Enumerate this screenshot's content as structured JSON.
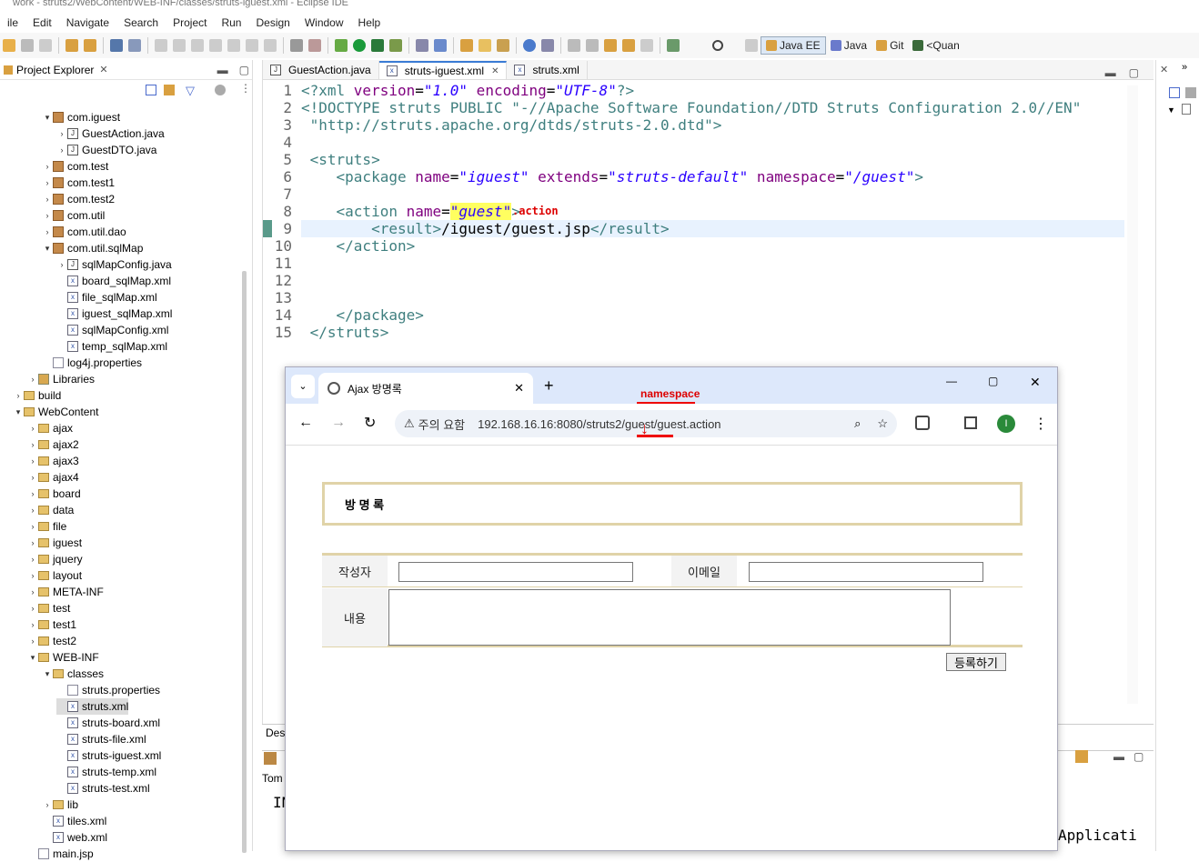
{
  "window": {
    "title": "work - struts2/WebContent/WEB-INF/classes/struts-iguest.xml - Eclipse IDE"
  },
  "menu": [
    "ile",
    "Edit",
    "Navigate",
    "Search",
    "Project",
    "Run",
    "Design",
    "Window",
    "Help"
  ],
  "perspectives": [
    "Java EE",
    "Java",
    "Git",
    "<Quan"
  ],
  "project_explorer": {
    "title": "Project Explorer",
    "items": [
      {
        "label": "com.iguest",
        "icon": "package"
      },
      {
        "label": "GuestAction.java",
        "icon": "java"
      },
      {
        "label": "GuestDTO.java",
        "icon": "java"
      },
      {
        "label": "com.test",
        "icon": "package"
      },
      {
        "label": "com.test1",
        "icon": "package"
      },
      {
        "label": "com.test2",
        "icon": "package"
      },
      {
        "label": "com.util",
        "icon": "package"
      },
      {
        "label": "com.util.dao",
        "icon": "package"
      },
      {
        "label": "com.util.sqlMap",
        "icon": "package"
      },
      {
        "label": "sqlMapConfig.java",
        "icon": "java"
      },
      {
        "label": "board_sqlMap.xml",
        "icon": "xml"
      },
      {
        "label": "file_sqlMap.xml",
        "icon": "xml"
      },
      {
        "label": "iguest_sqlMap.xml",
        "icon": "xml"
      },
      {
        "label": "sqlMapConfig.xml",
        "icon": "xml"
      },
      {
        "label": "temp_sqlMap.xml",
        "icon": "xml"
      },
      {
        "label": "log4j.properties",
        "icon": "props"
      },
      {
        "label": "Libraries",
        "icon": "lib"
      },
      {
        "label": "build",
        "icon": "folder"
      },
      {
        "label": "WebContent",
        "icon": "folder"
      },
      {
        "label": "ajax",
        "icon": "folder"
      },
      {
        "label": "ajax2",
        "icon": "folder"
      },
      {
        "label": "ajax3",
        "icon": "folder"
      },
      {
        "label": "ajax4",
        "icon": "folder"
      },
      {
        "label": "board",
        "icon": "folder"
      },
      {
        "label": "data",
        "icon": "folder"
      },
      {
        "label": "file",
        "icon": "folder"
      },
      {
        "label": "iguest",
        "icon": "folder"
      },
      {
        "label": "jquery",
        "icon": "folder"
      },
      {
        "label": "layout",
        "icon": "folder"
      },
      {
        "label": "META-INF",
        "icon": "folder"
      },
      {
        "label": "test",
        "icon": "folder"
      },
      {
        "label": "test1",
        "icon": "folder"
      },
      {
        "label": "test2",
        "icon": "folder"
      },
      {
        "label": "WEB-INF",
        "icon": "folder"
      },
      {
        "label": "classes",
        "icon": "folder"
      },
      {
        "label": "struts.properties",
        "icon": "props"
      },
      {
        "label": "struts.xml",
        "icon": "xml"
      },
      {
        "label": "struts-board.xml",
        "icon": "xml"
      },
      {
        "label": "struts-file.xml",
        "icon": "xml"
      },
      {
        "label": "struts-iguest.xml",
        "icon": "xml"
      },
      {
        "label": "struts-temp.xml",
        "icon": "xml"
      },
      {
        "label": "struts-test.xml",
        "icon": "xml"
      },
      {
        "label": "lib",
        "icon": "folder"
      },
      {
        "label": "tiles.xml",
        "icon": "xml"
      },
      {
        "label": "web.xml",
        "icon": "xml"
      },
      {
        "label": "main.jsp",
        "icon": "jsp"
      }
    ]
  },
  "editor": {
    "tabs": [
      "GuestAction.java",
      "struts-iguest.xml",
      "struts.xml"
    ],
    "line_numbers": [
      "1",
      "2",
      "3",
      "4",
      "5",
      "6",
      "7",
      "8",
      "9",
      "10",
      "11",
      "12",
      "13",
      "14",
      "15"
    ],
    "code": {
      "l1a": "<?xml ",
      "l1b": "version",
      "l1c": "=",
      "l1d": "\"1.0\"",
      "l1e": " encoding",
      "l1f": "=",
      "l1g": "\"UTF-8\"",
      "l1h": "?>",
      "l2": "<!DOCTYPE struts PUBLIC \"-//Apache Software Foundation//DTD Struts Configuration 2.0//EN\"",
      "l3": " \"http://struts.apache.org/dtds/struts-2.0.dtd\">",
      "l5": " <struts>",
      "l6a": "    <package ",
      "l6b": "name",
      "l6c": "=",
      "l6d": "\"iguest\"",
      "l6e": " extends",
      "l6f": "=",
      "l6g": "\"struts-default\"",
      "l6h": " namespace",
      "l6i": "=",
      "l6j": "\"/guest\"",
      "l6k": ">",
      "l8a": "    <action ",
      "l8b": "name",
      "l8c": "=",
      "l8d": "\"guest\"",
      "l8e": ">",
      "l9a": "        <result>",
      "l9b": "/iguest/guest.jsp",
      "l9c": "</result>",
      "l10": "    </action>",
      "l14": "    </package>",
      "l15": " </struts>"
    },
    "annotation": ".action"
  },
  "bottom": {
    "tab1": "Des",
    "tab2": "Tom",
    "text1": "IN",
    "right_text": "Applicati"
  },
  "browser": {
    "tab_title": "Ajax 방명록",
    "security": "주의 요함",
    "url": "192.168.16.16:8080/struts2/guest/guest.action",
    "annotation": "namespace",
    "profile": "I",
    "page": {
      "title": "방 명 록",
      "writer_label": "작성자",
      "email_label": "이메일",
      "content_label": "내용",
      "submit_label": "등록하기"
    }
  }
}
